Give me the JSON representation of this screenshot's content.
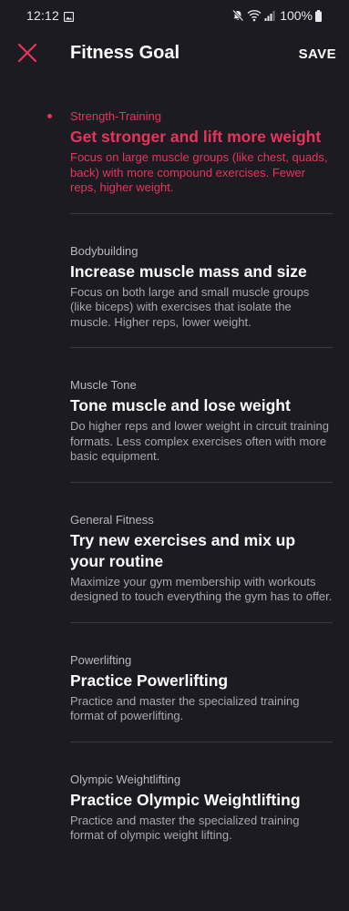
{
  "status_bar": {
    "time": "12:12",
    "left_icon": "image-notification-icon",
    "right_icons": [
      "mute-icon",
      "wifi-icon",
      "signal-icon",
      "battery-icon"
    ],
    "battery": "100%"
  },
  "header": {
    "title": "Fitness Goal",
    "close_icon": "close-icon",
    "save_label": "SAVE"
  },
  "colors": {
    "background": "#1c1b22",
    "accent": "#e8345c",
    "divider": "#3a3942"
  },
  "goals": [
    {
      "category": "Strength-Training",
      "title": "Get stronger and lift more weight",
      "description": "Focus on large muscle groups (like chest, quads, back) with more compound exercises. Fewer reps, higher weight.",
      "selected": true
    },
    {
      "category": "Bodybuilding",
      "title": "Increase muscle mass and size",
      "description": "Focus on both large and small muscle groups (like biceps) with exercises that isolate the muscle. Higher reps, lower weight.",
      "selected": false
    },
    {
      "category": "Muscle Tone",
      "title": "Tone muscle and lose weight",
      "description": "Do higher reps and lower weight in circuit training formats. Less complex exercises often with more basic equipment.",
      "selected": false
    },
    {
      "category": "General Fitness",
      "title": "Try new exercises and mix up your routine",
      "description": "Maximize your gym membership with workouts designed to touch everything the gym has to offer.",
      "selected": false
    },
    {
      "category": "Powerlifting",
      "title": "Practice Powerlifting",
      "description": "Practice and master the specialized training format of powerlifting.",
      "selected": false
    },
    {
      "category": "Olympic Weightlifting",
      "title": "Practice Olympic Weightlifting",
      "description": "Practice and master the specialized training format of olympic weight lifting.",
      "selected": false
    }
  ]
}
